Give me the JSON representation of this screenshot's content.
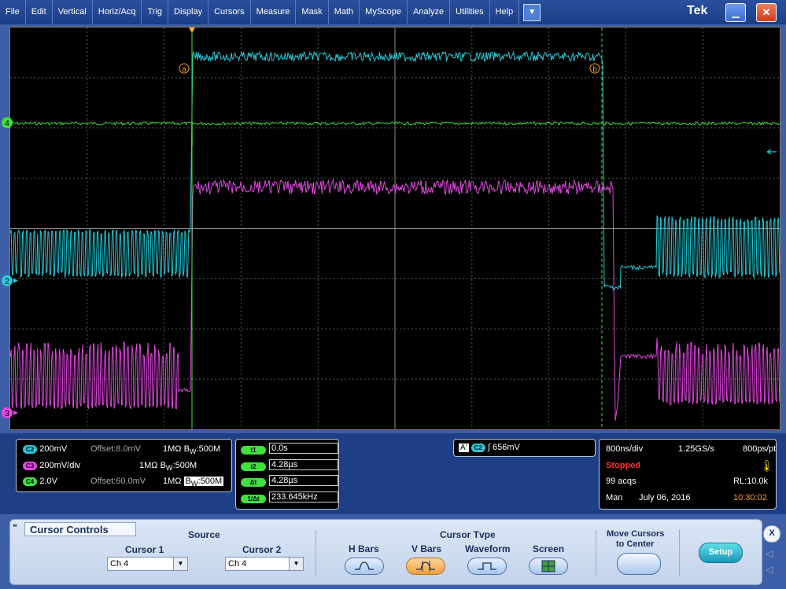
{
  "menu": [
    "File",
    "Edit",
    "Vertical",
    "Horiz/Acq",
    "Trig",
    "Display",
    "Cursors",
    "Measure",
    "Mask",
    "Math",
    "MyScope",
    "Analyze",
    "Utilities",
    "Help"
  ],
  "brand": "Tek",
  "markers": {
    "cursor_a": "a",
    "cursor_b": "b",
    "ch4": "4",
    "ch2": "2",
    "ch3": "3"
  },
  "channels": [
    {
      "badge": "C2",
      "scale": "200mV",
      "offset": "Offset:8.0mV",
      "impedance": "1MΩ",
      "bw": "B",
      "bw_sub": "W",
      "bw_val": ":500M",
      "color": "#26c9d8"
    },
    {
      "badge": "C3",
      "scale": "200mV/div",
      "offset": "",
      "impedance": "1MΩ",
      "bw": "B",
      "bw_sub": "W",
      "bw_val": ":500M",
      "color": "#e048e0"
    },
    {
      "badge": "C4",
      "scale": "2.0V",
      "offset": "Offset:60.0mV",
      "impedance": "1MΩ",
      "bw": "B",
      "bw_sub": "W",
      "bw_val": ":500M",
      "color": "#3fe03f"
    }
  ],
  "cursor_readout": [
    {
      "badge": "t1",
      "value": "0.0s"
    },
    {
      "badge": "t2",
      "value": "4.28µs"
    },
    {
      "badge": "Δt",
      "value": "4.28µs"
    },
    {
      "badge": "1/Δt",
      "value": "233.645kHz"
    }
  ],
  "trigger": {
    "source_a": "A'",
    "source_ch": "C2",
    "level": "656mV"
  },
  "acq": {
    "horiz": "800ns/div",
    "rate": "1.25GS/s",
    "res": "800ps/pt",
    "status": "Stopped",
    "acqs": "99 acqs",
    "rl": "RL:10.0k",
    "mode": "Man",
    "date": "July 06, 2016",
    "time": "10:30:02"
  },
  "cursor_controls": {
    "title": "Cursor Controls",
    "source_label": "Source",
    "cursor1_label": "Cursor 1",
    "cursor2_label": "Cursor 2",
    "cursor1_value": "Ch 4",
    "cursor2_value": "Ch 4",
    "type_label": "Cursor Tvpe",
    "types": [
      "H Bars",
      "V Bars",
      "Waveform",
      "Screen"
    ],
    "selected_type": "V Bars",
    "move_label_1": "Move Cursors",
    "move_label_2": "to Center",
    "setup": "Setup",
    "close": "X"
  }
}
